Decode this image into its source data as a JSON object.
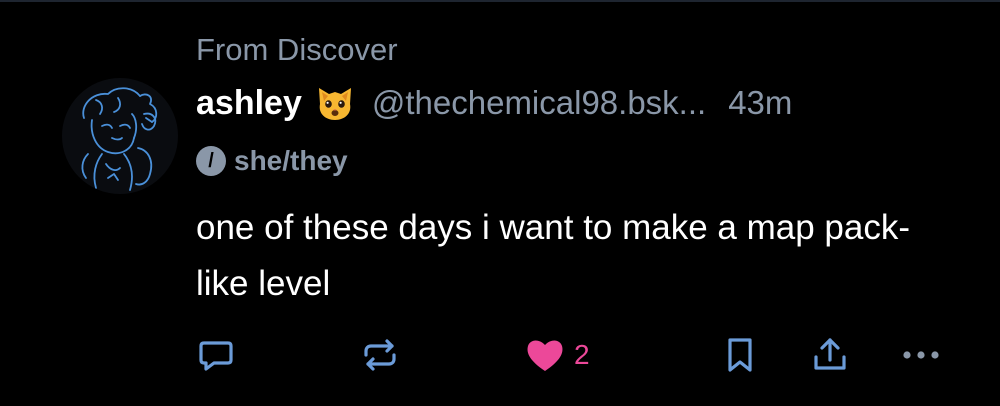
{
  "context": {
    "label": "From Discover"
  },
  "author": {
    "display_name": "ashley",
    "emoji_icon": "cat-face-icon",
    "handle": "@thechemical98.bsk...",
    "timestamp": "43m",
    "pronouns": "she/they",
    "pronoun_icon_glyph": "/"
  },
  "post": {
    "text": "one of these days i want to make a map pack-like level"
  },
  "actions": {
    "reply_icon": "comment-icon",
    "repost_icon": "repost-icon",
    "like_icon": "heart-icon",
    "like_count": "2",
    "bookmark_icon": "bookmark-icon",
    "share_icon": "share-icon",
    "more_icon": "more-icon"
  },
  "colors": {
    "background": "#000000",
    "primary_text": "#ffffff",
    "secondary_text": "#8a97a8",
    "like_pink": "#ec4899",
    "avatar_line": "#4a90d9"
  }
}
